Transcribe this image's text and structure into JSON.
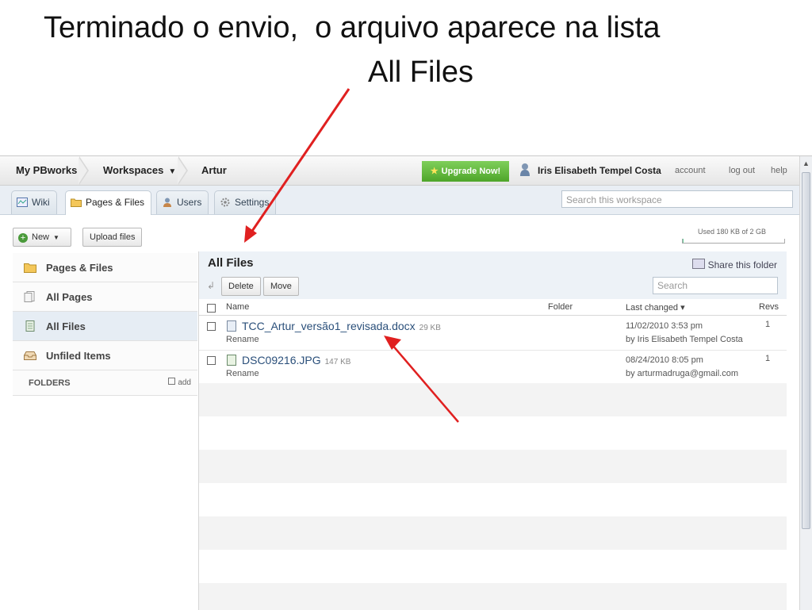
{
  "slide": {
    "title_line1": "Terminado o envio,  o arquivo aparece na lista",
    "title_line2": "All Files"
  },
  "topnav": {
    "my_pbworks": "My PBworks",
    "workspaces": "Workspaces",
    "workspace_name": "Artur",
    "upgrade": "Upgrade Now!",
    "user": "Iris Elisabeth Tempel Costa",
    "account": "account",
    "logout": "log out",
    "help": "help"
  },
  "tabs": [
    {
      "label": "Wiki",
      "icon": "wiki-icon"
    },
    {
      "label": "Pages & Files",
      "icon": "folder-icon",
      "active": true
    },
    {
      "label": "Users",
      "icon": "users-icon"
    },
    {
      "label": "Settings",
      "icon": "gear-icon"
    }
  ],
  "workspace_search": {
    "placeholder": "Search this workspace"
  },
  "actions": {
    "new": "New",
    "upload": "Upload files",
    "usage": "Used 180 KB of 2 GB",
    "usage_fraction": 0.0001
  },
  "sidebar": {
    "items": [
      {
        "label": "Pages & Files",
        "icon": "folder-icon"
      },
      {
        "label": "All Pages",
        "icon": "pages-icon"
      },
      {
        "label": "All Files",
        "icon": "file-icon",
        "active": true
      },
      {
        "label": "Unfiled Items",
        "icon": "inbox-icon"
      }
    ],
    "folders_label": "FOLDERS",
    "add_label": "add"
  },
  "main": {
    "title": "All Files",
    "share": "Share this folder",
    "delete": "Delete",
    "move": "Move",
    "search_placeholder": "Search",
    "columns": {
      "name": "Name",
      "folder": "Folder",
      "changed": "Last changed ▾",
      "revs": "Revs"
    },
    "files": [
      {
        "name": "TCC_Artur_versão1_revisada.docx",
        "size": "29 KB",
        "action": "Rename",
        "date": "11/02/2010 3:53 pm",
        "by": "by Iris Elisabeth Tempel Costa",
        "revs": "1"
      },
      {
        "name": "DSC09216.JPG",
        "size": "147 KB",
        "action": "Rename",
        "date": "08/24/2010 8:05 pm",
        "by": "by arturmadruga@gmail.com",
        "revs": "1"
      }
    ]
  },
  "colors": {
    "upgrade_green": "#4ea52a",
    "link_blue": "#2a4f7a",
    "arrow_red": "#e02020",
    "sidebar_active": "#e6edf4"
  }
}
